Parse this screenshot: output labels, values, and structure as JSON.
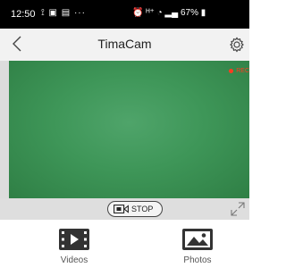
{
  "status_bar": {
    "time": "12:50",
    "left_icons": "⟟ ▣ ▤ ···",
    "right_icons": "⏰ ᴴ⁺ ◔ ▂▄ 67% ▮",
    "battery": "67%"
  },
  "header": {
    "title": "TimaCam",
    "back_icon": "chevron-left-icon",
    "settings_icon": "gear-icon"
  },
  "video": {
    "rec_label": "REC"
  },
  "controls": {
    "stop_label": "STOP",
    "fullscreen_icon": "expand-icon"
  },
  "tabs": [
    {
      "label": "Videos",
      "icon": "video-file-icon"
    },
    {
      "label": "Photos",
      "icon": "image-icon"
    }
  ]
}
